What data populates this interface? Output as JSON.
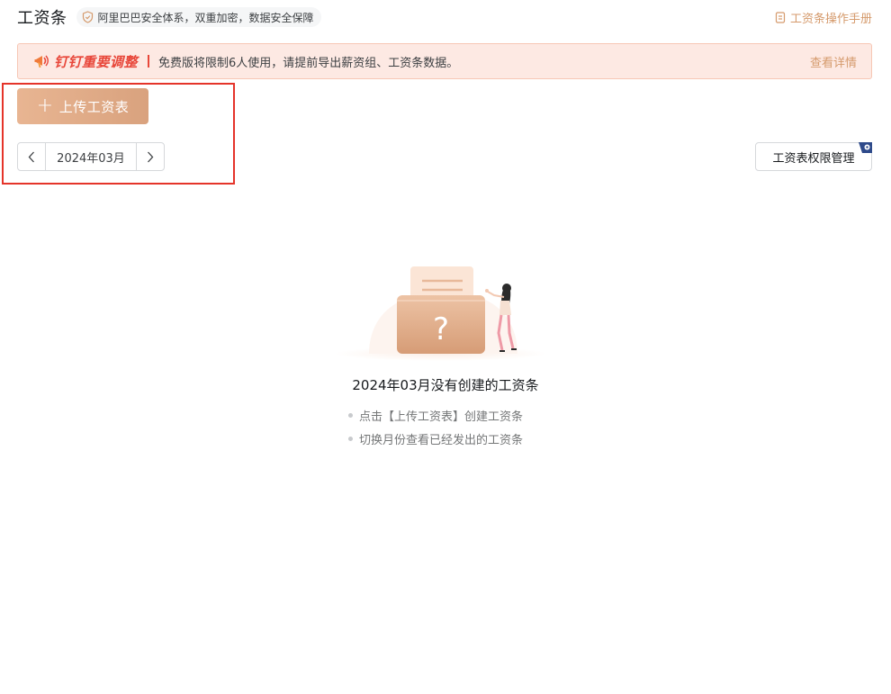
{
  "header": {
    "title": "工资条",
    "security_text": "阿里巴巴安全体系，双重加密，数据安全保障",
    "manual_link": "工资条操作手册"
  },
  "notice": {
    "brand": "钉钉重要调整",
    "text": "免费版将限制6人使用，请提前导出薪资组、工资条数据。",
    "link": "查看详情"
  },
  "toolbar": {
    "upload_label": "上传工资表",
    "upload_icon": "plus-icon"
  },
  "month_picker": {
    "value": "2024年03月",
    "prev_icon": "chevron-left-icon",
    "next_icon": "chevron-right-icon"
  },
  "permissions": {
    "label": "工资表权限管理"
  },
  "empty_state": {
    "title": "2024年03月没有创建的工资条",
    "hints": [
      "点击【上传工资表】创建工资条",
      "切换月份查看已经发出的工资条"
    ]
  },
  "colors": {
    "accent": "#d59a6c",
    "button_gradient_start": "#e8b592",
    "button_gradient_end": "#d9a27e",
    "notice_bg": "#fde9e3",
    "notice_brand": "#e8473a",
    "highlight": "#e5342a"
  }
}
